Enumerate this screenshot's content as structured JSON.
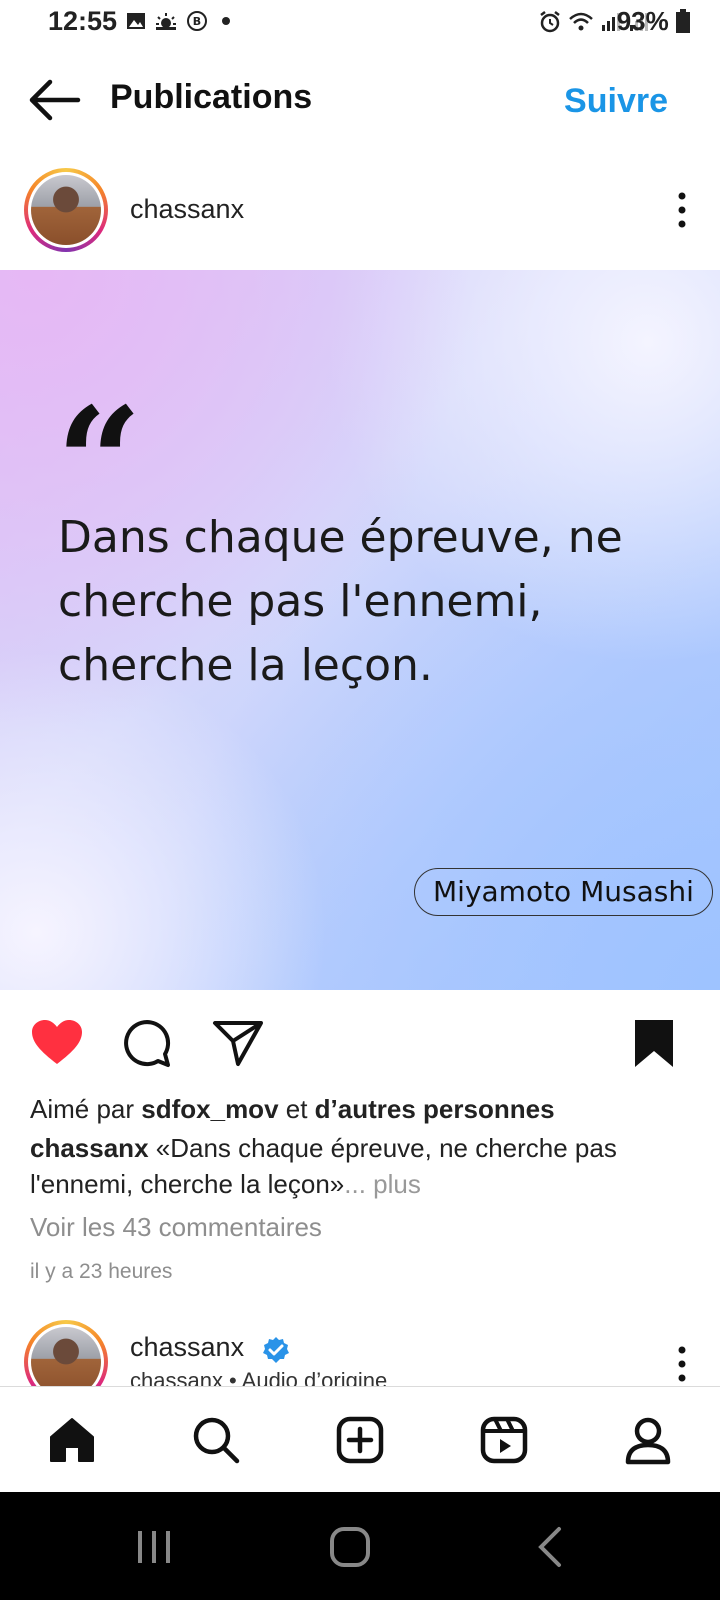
{
  "status_bar": {
    "time": "12:55",
    "battery": "93%"
  },
  "header": {
    "title": "Publications",
    "follow_label": "Suivre"
  },
  "post": {
    "username": "chassanx",
    "quote_mark": "“",
    "quote_text": "Dans chaque épreuve, ne cherche pas l'ennemi, cherche la leçon.",
    "author": "Miyamoto Musashi",
    "liked": true,
    "saved": true,
    "likes": {
      "prefix": "Aimé par ",
      "user": "sdfox_mov",
      "middle": " et ",
      "others": "d’autres personnes"
    },
    "caption": {
      "username": "chassanx",
      "text": " «Dans chaque épreuve, ne cherche pas l'ennemi, cherche la leçon»",
      "more": "... plus"
    },
    "comments_link": "Voir les 43 commentaires",
    "timestamp": "il y a 23 heures"
  },
  "next_post": {
    "username": "chassanx",
    "subline": "chassanx • Audio d’origine"
  },
  "colors": {
    "accent_blue": "#1a95e6",
    "like_red": "#ff3040"
  }
}
